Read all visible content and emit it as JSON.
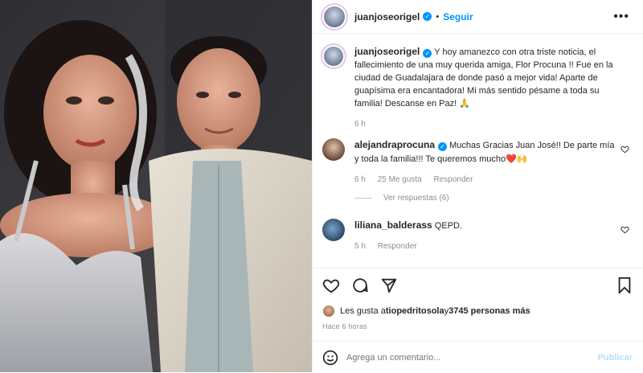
{
  "post": {
    "author": "juanjoseorigel",
    "follow_label": "Seguir",
    "separator": "•",
    "more_label": "•••"
  },
  "caption": {
    "author": "juanjoseorigel",
    "text": "Y hoy amanezco con otra triste noticia, el fallecimiento de una muy querida amiga, Flor Procuna !! Fue en la ciudad de Guadalajara de donde pasó a mejor vida! Aparte de guapísima era encantadora! Mi más sentido pésame a toda su familia! Descanse en Paz! 🙏",
    "time": "6 h"
  },
  "comments": [
    {
      "author": "alejandraprocuna",
      "text": "Muchas Gracias Juan José!! De parte mía y toda la familia!!! Te queremos mucho❤️🙌",
      "time": "6 h",
      "likes": "25 Me gusta",
      "reply_label": "Responder",
      "verified": true
    },
    {
      "author": "liliana_balderass",
      "text": "QEPD.",
      "time": "5 h",
      "reply_label": "Responder",
      "verified": false
    }
  ],
  "view_replies": "Ver respuestas (6)",
  "likes": {
    "prefix": "Les gusta a ",
    "user": "tiopedritosola",
    "middle": " y ",
    "count": "3745 personas más"
  },
  "posted_ago": "Hace 6 horas",
  "add_comment": {
    "placeholder": "Agrega un comentario...",
    "publish_label": "Publicar"
  },
  "colors": {
    "accent": "#0095f6",
    "muted": "#8e8e8e",
    "text": "#262626"
  },
  "icons": [
    "heart-icon",
    "comment-icon",
    "share-icon",
    "bookmark-icon",
    "emoji-icon",
    "more-icon",
    "verified-icon"
  ]
}
